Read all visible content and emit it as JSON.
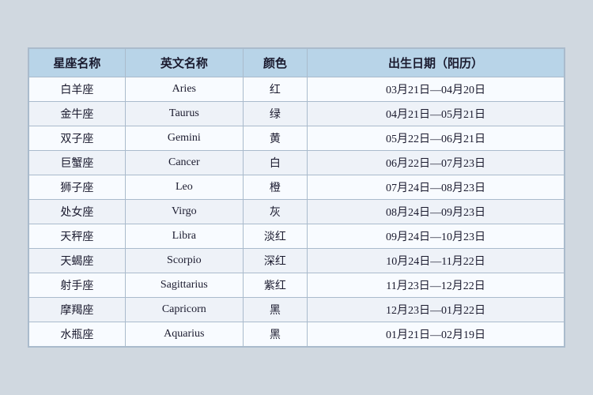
{
  "table": {
    "headers": [
      "星座名称",
      "英文名称",
      "颜色",
      "出生日期（阳历）"
    ],
    "rows": [
      {
        "cn": "白羊座",
        "en": "Aries",
        "color": "红",
        "date": "03月21日—04月20日"
      },
      {
        "cn": "金牛座",
        "en": "Taurus",
        "color": "绿",
        "date": "04月21日—05月21日"
      },
      {
        "cn": "双子座",
        "en": "Gemini",
        "color": "黄",
        "date": "05月22日—06月21日"
      },
      {
        "cn": "巨蟹座",
        "en": "Cancer",
        "color": "白",
        "date": "06月22日—07月23日"
      },
      {
        "cn": "狮子座",
        "en": "Leo",
        "color": "橙",
        "date": "07月24日—08月23日"
      },
      {
        "cn": "处女座",
        "en": "Virgo",
        "color": "灰",
        "date": "08月24日—09月23日"
      },
      {
        "cn": "天秤座",
        "en": "Libra",
        "color": "淡红",
        "date": "09月24日—10月23日"
      },
      {
        "cn": "天蝎座",
        "en": "Scorpio",
        "color": "深红",
        "date": "10月24日—11月22日"
      },
      {
        "cn": "射手座",
        "en": "Sagittarius",
        "color": "紫红",
        "date": "11月23日—12月22日"
      },
      {
        "cn": "摩羯座",
        "en": "Capricorn",
        "color": "黑",
        "date": "12月23日—01月22日"
      },
      {
        "cn": "水瓶座",
        "en": "Aquarius",
        "color": "黑",
        "date": "01月21日—02月19日"
      }
    ]
  }
}
